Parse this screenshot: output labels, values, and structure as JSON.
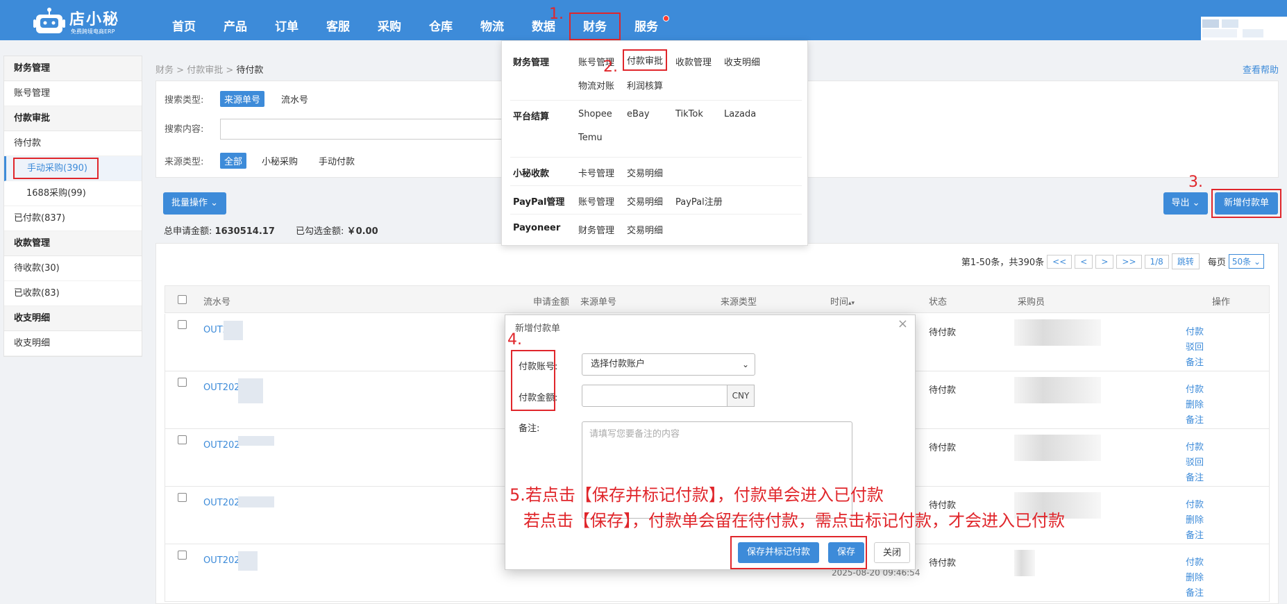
{
  "logo": {
    "name": "店小秘",
    "subtitle": "免费跨境电商ERP"
  },
  "nav": [
    {
      "label": "首页"
    },
    {
      "label": "产品"
    },
    {
      "label": "订单"
    },
    {
      "label": "客服"
    },
    {
      "label": "采购"
    },
    {
      "label": "仓库"
    },
    {
      "label": "物流"
    },
    {
      "label": "数据"
    },
    {
      "label": "财务"
    },
    {
      "label": "服务"
    }
  ],
  "sidebar": {
    "g1": "财务管理",
    "g1_items": [
      "账号管理"
    ],
    "g2": "付款审批",
    "g2_items": [
      "待付款",
      "手动采购(390)",
      "1688采购(99)",
      "已付款(837)"
    ],
    "g3": "收款管理",
    "g3_items": [
      "待收款(30)",
      "已收款(83)"
    ],
    "g4": "收支明细",
    "g4_items": [
      "收支明细"
    ]
  },
  "breadcrumb": {
    "a": "财务",
    "b": "付款审批",
    "c": "待付款",
    "sep": ">"
  },
  "help": "查看帮助",
  "filter": {
    "search_type_label": "搜索类型:",
    "search_type_opts": [
      "来源单号",
      "流水号"
    ],
    "search_content_label": "搜索内容:",
    "source_type_label": "来源类型:",
    "source_type_opts": [
      "全部",
      "小秘采购",
      "手动付款"
    ]
  },
  "actions": {
    "batch": "批量操作",
    "export": "导出",
    "new_payment": "新增付款单"
  },
  "summary": {
    "total_label": "总申请金额:",
    "total_value": "1630514.17",
    "checked_label": "已勾选金额:",
    "checked_value": "￥0.00"
  },
  "pager": {
    "info": "第1-50条，共390条",
    "first": "<<",
    "prev": "<",
    "next": ">",
    "last": ">>",
    "page": "1/8",
    "jump": "跳转",
    "per_page_label": "每页",
    "per_page": "50条"
  },
  "table": {
    "headers": [
      "流水号",
      "申请金额",
      "来源单号",
      "来源类型",
      "时间",
      "状态",
      "采购员",
      "操作"
    ],
    "rows": [
      {
        "serial": "OUT2",
        "status": "待付款",
        "ops": [
          "付款",
          "驳回",
          "备注"
        ]
      },
      {
        "serial": "OUT202",
        "status": "待付款",
        "ops": [
          "付款",
          "删除",
          "备注"
        ]
      },
      {
        "serial": "OUT202",
        "status": "待付款",
        "ops": [
          "付款",
          "驳回",
          "备注"
        ]
      },
      {
        "serial": "OUT202",
        "status": "待付款",
        "ops": [
          "付款",
          "删除",
          "备注"
        ]
      },
      {
        "serial": "OUT202",
        "status": "待付款",
        "ops": [
          "付款",
          "删除",
          "备注"
        ],
        "time": "2025-08-20 09:46:54"
      }
    ]
  },
  "dropdown": {
    "groups": [
      {
        "title": "财务管理",
        "links": [
          "账号管理",
          "付款审批",
          "收款管理",
          "收支明细",
          "物流对账",
          "利润核算"
        ]
      },
      {
        "title": "平台结算",
        "links": [
          "Shopee",
          "eBay",
          "TikTok",
          "Lazada",
          "Temu"
        ]
      },
      {
        "title": "小秘收款",
        "links": [
          "卡号管理",
          "交易明细"
        ]
      },
      {
        "title": "PayPal管理",
        "links": [
          "账号管理",
          "交易明细",
          "PayPal注册"
        ]
      },
      {
        "title": "Payoneer",
        "links": [
          "财务管理",
          "交易明细"
        ]
      }
    ]
  },
  "modal": {
    "title": "新增付款单",
    "close": "×",
    "account_label": "付款账号:",
    "account_value": "选择付款账户",
    "amount_label": "付款金额:",
    "currency": "CNY",
    "note_label": "备注:",
    "note_placeholder": "请填写您要备注的内容",
    "btn_save_mark": "保存并标记付款",
    "btn_save": "保存",
    "btn_close": "关闭"
  },
  "annotations": {
    "s1": "1.",
    "s2": "2.",
    "s3": "3.",
    "s4": "4.",
    "s5a": "5.若点击【保存并标记付款】，付款单会进入已付款",
    "s5b": "若点击【保存】，付款单会留在待付款，需点击标记付款，才会进入已付款"
  },
  "colors": {
    "primary": "#3d8bd9",
    "annotation": "#e0262b"
  }
}
